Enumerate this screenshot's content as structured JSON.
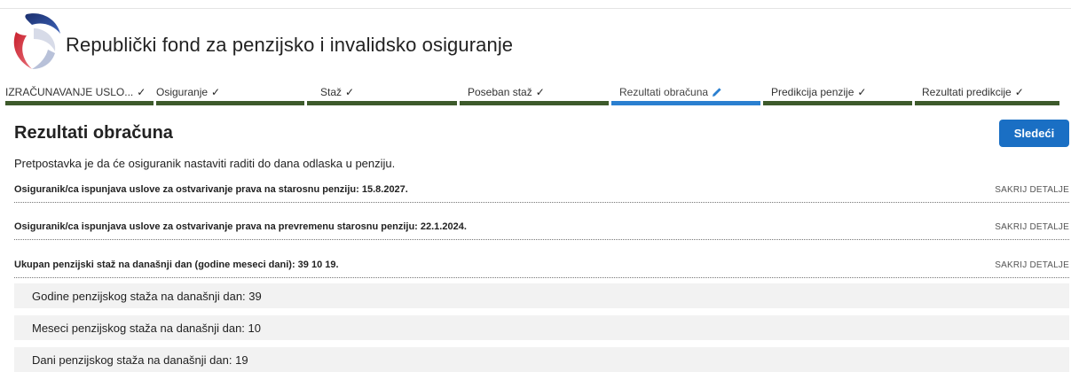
{
  "header": {
    "org_title": "Republički fond za penzijsko i invalidsko osiguranje"
  },
  "steps": [
    {
      "label": "IZRAČUNAVANJE USLO...",
      "status_icon": "check-icon"
    },
    {
      "label": "Osiguranje",
      "status_icon": "check-icon"
    },
    {
      "label": "Staž",
      "status_icon": "check-icon"
    },
    {
      "label": "Poseban staž",
      "status_icon": "check-icon"
    },
    {
      "label": "Rezultati obračuna",
      "status_icon": "pencil-icon"
    },
    {
      "label": "Predikcija penzije",
      "status_icon": "check-icon"
    },
    {
      "label": "Rezultati predikcije",
      "status_icon": "check-icon"
    }
  ],
  "colors": {
    "step_done": "#3d5a2b",
    "step_active": "#2a7fd0",
    "primary_button": "#1a6fc4",
    "info_row_bg": "#f2f2f2"
  },
  "main": {
    "title": "Rezultati obračuna",
    "next_button": "Sledeći",
    "assumption": "Pretpostavka je da će osiguranik nastaviti raditi do dana odlaska u penziju.",
    "details": [
      {
        "text": "Osiguranik/ca ispunjava uslove za ostvarivanje prava na starosnu penziju: 15.8.2027.",
        "toggle": "SAKRIJ DETALJE"
      },
      {
        "text": "Osiguranik/ca ispunjava uslove za ostvarivanje prava na prevremenu starosnu penziju: 22.1.2024.",
        "toggle": "SAKRIJ DETALJE"
      },
      {
        "text": "Ukupan penzijski staž na današnji dan (godine meseci dani): 39 10 19.",
        "toggle": "SAKRIJ DETALJE"
      }
    ],
    "stats": [
      "Godine penzijskog staža na današnji dan: 39",
      "Meseci penzijskog staža na današnji dan: 10",
      "Dani penzijskog staža na današnji dan: 19"
    ]
  }
}
